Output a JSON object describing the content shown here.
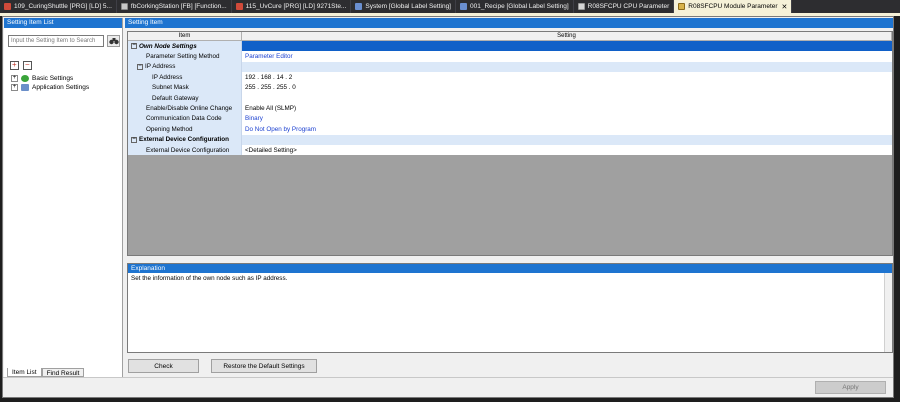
{
  "tabs": [
    {
      "label": "109_CuringShuttle [PRG] [LD] 5...",
      "icon": "program-icon"
    },
    {
      "label": "fbCorkingStation [FB] [Function...",
      "icon": "function-block-icon"
    },
    {
      "label": "115_UvCure [PRG] [LD] 9271Ste...",
      "icon": "program-icon"
    },
    {
      "label": "System [Global Label Setting]",
      "icon": "label-icon"
    },
    {
      "label": "001_Recipe [Global Label Setting]",
      "icon": "label-icon"
    },
    {
      "label": "R08SFCPU CPU Parameter",
      "icon": "cpu-icon"
    },
    {
      "label": "R08SFCPU Module Parameter",
      "icon": "module-icon",
      "active": true,
      "close": "✕"
    }
  ],
  "left_pane": {
    "title": "Setting Item List",
    "search_placeholder": "Input the Setting Item to Search",
    "tree": [
      {
        "label": "Basic Settings",
        "expander": "+"
      },
      {
        "label": "Application Settings",
        "expander": "+"
      }
    ],
    "bottom_tabs": [
      "Item List",
      "Find Result"
    ]
  },
  "right_pane": {
    "title": "Setting Item",
    "columns": [
      "Item",
      "Setting"
    ],
    "rows": [
      {
        "item": "Own Node Settings",
        "setting": "",
        "kind": "section"
      },
      {
        "item": "Parameter Setting Method",
        "setting": "Parameter Editor",
        "kind": "value",
        "link": true
      },
      {
        "item": "IP Address",
        "setting": "",
        "kind": "subsection"
      },
      {
        "item": "IP Address",
        "setting": "192 . 168 . 14 . 2",
        "kind": "value"
      },
      {
        "item": "Subnet Mask",
        "setting": "255 . 255 . 255 . 0",
        "kind": "value"
      },
      {
        "item": "Default Gateway",
        "setting": "",
        "kind": "value"
      },
      {
        "item": "Enable/Disable Online Change",
        "setting": "Enable All (SLMP)",
        "kind": "value"
      },
      {
        "item": "Communication Data Code",
        "setting": "Binary",
        "kind": "value",
        "link": true
      },
      {
        "item": "Opening Method",
        "setting": "Do Not Open by Program",
        "kind": "value",
        "link": true
      },
      {
        "item": "External Device Configuration",
        "setting": "",
        "kind": "section2"
      },
      {
        "item": "External Device Configuration",
        "setting": "<Detailed Setting>",
        "kind": "value"
      }
    ],
    "explanation_title": "Explanation",
    "explanation_text": "Set the information of the own node such as IP address.",
    "check_button": "Check",
    "restore_button": "Restore the Default Settings"
  },
  "apply_button": "Apply"
}
